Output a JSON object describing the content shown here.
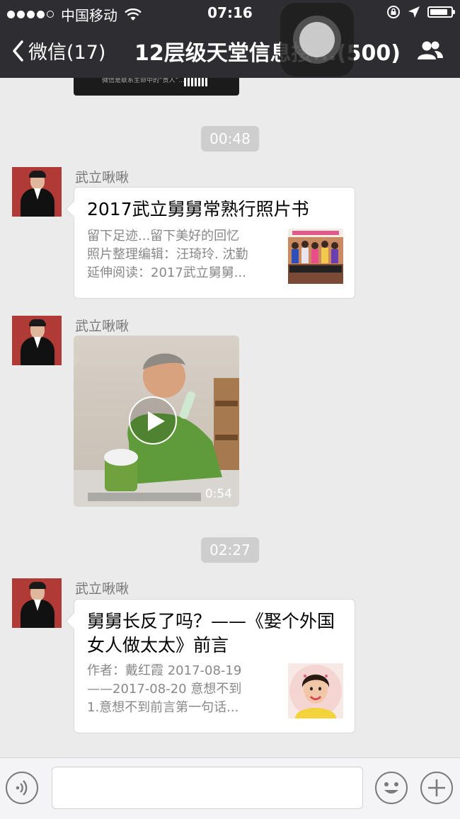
{
  "status_bar": {
    "carrier": "中国移动",
    "time": "07:16",
    "battery_level": 0.85
  },
  "nav": {
    "back_label": "微信(17)",
    "title": "12层级天堂信息接...(500)"
  },
  "previous_message_caption": "微信是联系生命中的“贵人”...",
  "messages": [
    {
      "type": "timestamp",
      "text": "00:48"
    },
    {
      "type": "link_card",
      "sender": "武立啾啾",
      "title": "2017武立舅舅常熟行照片书",
      "desc": [
        "留下足迹...留下美好的回忆",
        "照片整理编辑：汪琦玲. 沈勤",
        "延伸阅读：2017武立舅舅..."
      ],
      "thumb": "group-photo"
    },
    {
      "type": "video",
      "sender": "武立啾啾",
      "duration": "0:54"
    },
    {
      "type": "timestamp",
      "text": "02:27"
    },
    {
      "type": "link_card",
      "sender": "武立啾啾",
      "title": "舅舅长反了吗？——《娶个外国女人做太太》前言",
      "desc": [
        "作者：戴红霞 2017-08-19",
        "——2017-08-20 意想不到",
        "1.意想不到前言第一句话..."
      ],
      "thumb": "woman-portrait"
    }
  ],
  "input_bar": {
    "placeholder": "",
    "icons": [
      "voice-icon",
      "emoji-icon",
      "plus-icon"
    ]
  }
}
